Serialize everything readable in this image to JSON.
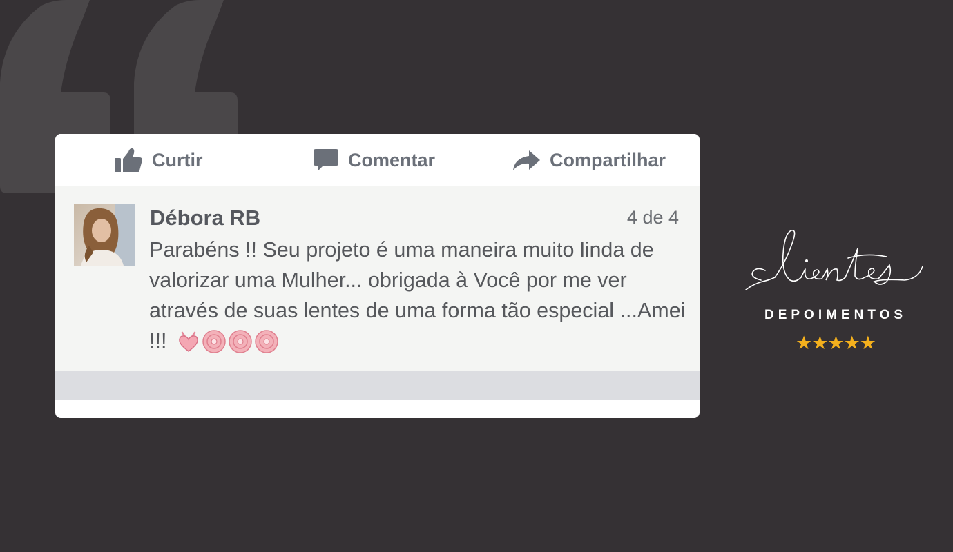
{
  "card": {
    "actions": {
      "like_label": "Curtir",
      "comment_label": "Comentar",
      "share_label": "Compartilhar"
    },
    "comment": {
      "author": "Débora RB",
      "counter": "4 de 4",
      "text": "Parabéns !! Seu projeto é uma maneira muito linda  de valorizar uma Mulher... obrigada à Você por me ver através de suas lentes de uma forma tão especial ...Amei !!!",
      "emojis": [
        "heart-icon",
        "flower-icon",
        "flower-icon",
        "flower-icon"
      ]
    }
  },
  "brand": {
    "script": "clientes",
    "subtitle": "DEPOIMENTOS",
    "stars": "★★★★★",
    "rating": 5,
    "star_color": "#f4b01d"
  },
  "colors": {
    "background": "#353134",
    "quote_mark": "#4a4749",
    "card": "#ffffff",
    "comment_bg": "#f4f5f3",
    "reply_strip": "#dcdde1",
    "action_text": "#6b7079"
  }
}
